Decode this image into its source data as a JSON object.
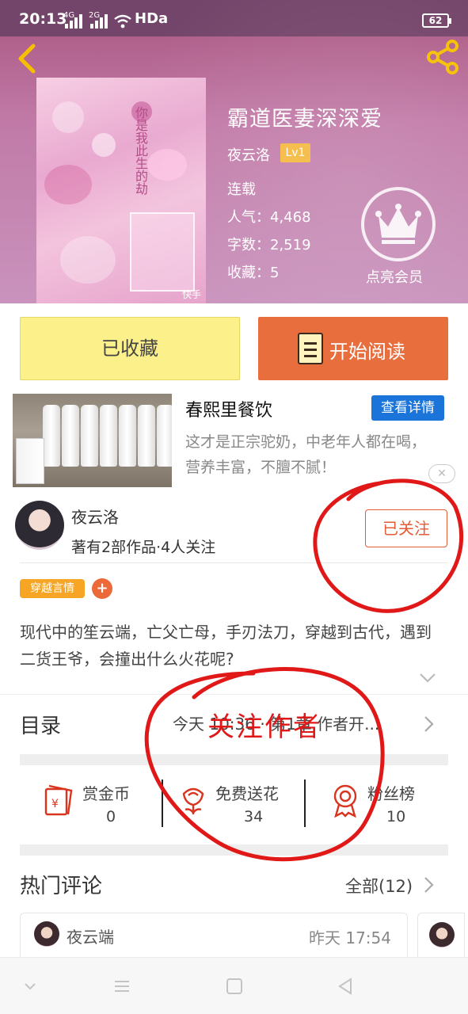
{
  "status_bar": {
    "time": "20:13",
    "net1": "4G",
    "net2": "2G",
    "hd": "HDa",
    "battery": "62"
  },
  "book": {
    "title": "霸道医妻深深爱",
    "author": "夜云洛",
    "level": "Lv1",
    "status": "连载",
    "popularity": "人气：4,468",
    "words": "字数：2,519",
    "favorites": "收藏：5",
    "cover_watermark": "快手",
    "cover_text": "你是我此生的劫"
  },
  "vip": {
    "label": "点亮会员"
  },
  "buttons": {
    "collected": "已收藏",
    "start_reading": "开始阅读"
  },
  "ad": {
    "title": "春熙里餐饮",
    "detail_button": "查看详情",
    "description": "这才是正宗驼奶，中老年人都在喝，营养丰富，不膻不腻！"
  },
  "author_card": {
    "name": "夜云洛",
    "meta": "著有2部作品·4人关注",
    "follow_button": "已关注"
  },
  "tags": {
    "genre": "穿越言情",
    "add": "+"
  },
  "summary": "现代中的笙云端，亡父亡母，手刃法刀，穿越到古代，遇到二货王爷，会撞出什么火花呢?",
  "toc": {
    "title": "目录",
    "latest": "今天 10:36 · 第1章 作者开..."
  },
  "rewards": [
    {
      "label": "赏金币",
      "value": "0"
    },
    {
      "label": "免费送花",
      "value": "34"
    },
    {
      "label": "粉丝榜",
      "value": "10"
    }
  ],
  "hot_comments": {
    "title": "热门评论",
    "all": "全部(12)",
    "first": {
      "user": "夜云端",
      "time": "昨天 17:54"
    }
  },
  "annotation": {
    "text": "关注作者",
    "color": "#e01818"
  },
  "colors": {
    "accent_orange": "#e86e3e",
    "collected_yellow": "#fbf089",
    "link_blue": "#1b74d9",
    "tag_orange": "#f6a624"
  }
}
